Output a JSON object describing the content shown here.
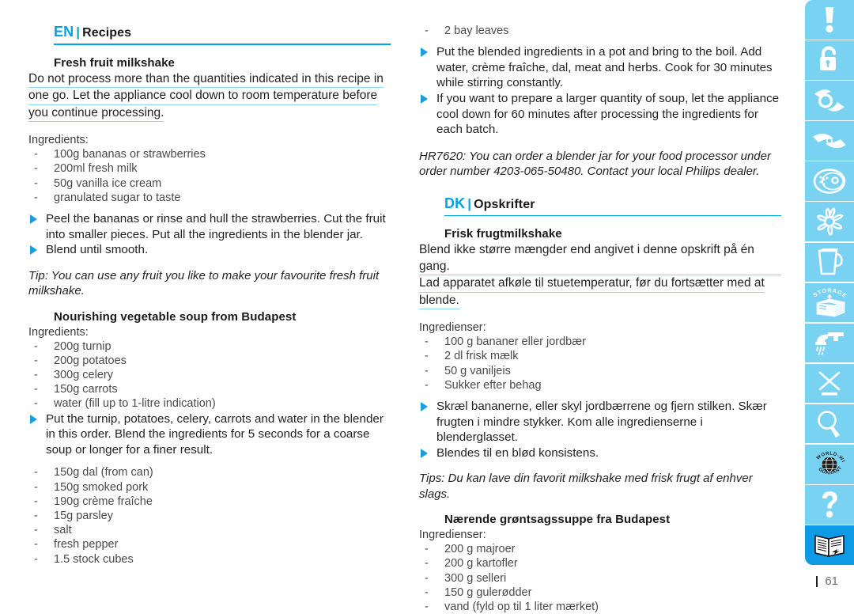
{
  "page": {
    "number": "61",
    "accent_color": "#00a3e8",
    "underline_color": "#8fd8f5",
    "rail_color": "#79d2f2",
    "rail_last_color": "#0f9ae5"
  },
  "left_column": {
    "header": {
      "code": "EN",
      "pipe": "|",
      "title": "Recipes"
    },
    "recipe1": {
      "title": "Fresh fruit milkshake",
      "warning_lines": [
        "Do not process more than the quantities indicated in this recipe in",
        "one go. Let the appliance cool down to room temperature before",
        "you continue processing."
      ],
      "ingredients_label": "Ingredients:",
      "ingredients": [
        "100g bananas or strawberries",
        "200ml fresh milk",
        "50g vanilla ice cream",
        "granulated sugar to taste"
      ],
      "steps": [
        "Peel the bananas or rinse and hull the strawberries. Cut the fruit into smaller pieces. Put all the ingredients in the blender jar.",
        "Blend until smooth."
      ],
      "tip": "Tip: You can use any fruit you like to make your favourite fresh fruit milkshake."
    },
    "recipe2": {
      "title": "Nourishing vegetable soup from Budapest",
      "ingredients_label": "Ingredients:",
      "ingredients_part1": [
        "200g turnip",
        "200g potatoes",
        "300g celery",
        "150g carrots",
        "water (fill up to 1-litre indication)"
      ],
      "steps": [
        "Put the turnip, potatoes, celery, carrots and water in the blender in this order. Blend the ingredients for 5 seconds for a coarse soup or longer for a finer result."
      ],
      "ingredients_part2": [
        "150g dal (from can)",
        "150g smoked pork",
        "190g crème fraîche",
        "15g parsley",
        "salt",
        "fresh pepper",
        "1.5 stock cubes"
      ]
    }
  },
  "right_column": {
    "continued_ingredients": [
      "2 bay leaves"
    ],
    "continued_steps": [
      "Put the blended ingredients in a pot and bring to the boil. Add water, crème fraîche, dal, meat and herbs. Cook for 30 minutes while stirring constantly.",
      "If you want to prepare a larger quantity of soup, let the appliance cool down for 60 minutes after processing the ingredients for each batch."
    ],
    "order_note": "HR7620: You can order a blender jar for your food processor under order number 4203-065-50480. Contact your local Philips dealer.",
    "header": {
      "code": "DK",
      "pipe": "|",
      "title": "Opskrifter"
    },
    "recipe1": {
      "title": "Frisk frugtmilkshake",
      "warning_lines": [
        "Blend ikke større mængder end angivet i denne opskrift på én gang.",
        "Lad apparatet afkøle til stuetemperatur, før du fortsætter med at",
        "blende."
      ],
      "ingredients_label": "Ingredienser:",
      "ingredients": [
        "100 g bananer eller jordbær",
        "2 dl frisk mælk",
        "50 g vaniljeis",
        "Sukker efter behag"
      ],
      "steps": [
        "Skræl bananerne, eller skyl jordbærrene og fjern stilken. Skær frugten i mindre stykker. Kom alle ingredienserne i blenderglasset.",
        "Blendes til en blød konsistens."
      ],
      "tip": "Tips: Du kan lave din favorit milkshake med frisk frugt af enhver slags."
    },
    "recipe2": {
      "title": "Nærende grøntsagssuppe fra Budapest",
      "ingredients_label": "Ingredienser:",
      "ingredients": [
        "200 g majroer",
        "200 g kartofler",
        "300 g selleri",
        "150 g gulerødder",
        "vand (fyld op til 1 liter mærket)"
      ]
    }
  },
  "icon_rail": {
    "items": [
      {
        "name": "exclamation-mark-icon",
        "label": "Important / warning"
      },
      {
        "name": "open-padlock-icon",
        "label": "Safety lock"
      },
      {
        "name": "blade-with-ring-icon",
        "label": "Blade unit"
      },
      {
        "name": "blade-icon",
        "label": "Blade"
      },
      {
        "name": "shredding-disc-icon",
        "label": "Shredding disc"
      },
      {
        "name": "emulsifying-disc-icon",
        "label": "Emulsifying disc"
      },
      {
        "name": "blender-jar-icon",
        "label": "Blender jar"
      },
      {
        "name": "storage-box-icon",
        "label": "Storage"
      },
      {
        "name": "water-tap-icon",
        "label": "Cleaning"
      },
      {
        "name": "crossed-bin-icon",
        "label": "Environment / disposal"
      },
      {
        "name": "magnifying-glass-icon",
        "label": "Troubleshooting"
      },
      {
        "name": "worldwide-guarantee-icon",
        "label": "Worldwide guarantee"
      },
      {
        "name": "question-mark-icon",
        "label": "Frequently asked questions"
      },
      {
        "name": "open-book-icon",
        "label": "Index / manual"
      }
    ],
    "storage_label": "STORAGE",
    "guarantee_label_top": "WORLD-WIDE",
    "guarantee_label_bottom": "GUARANTEE"
  }
}
